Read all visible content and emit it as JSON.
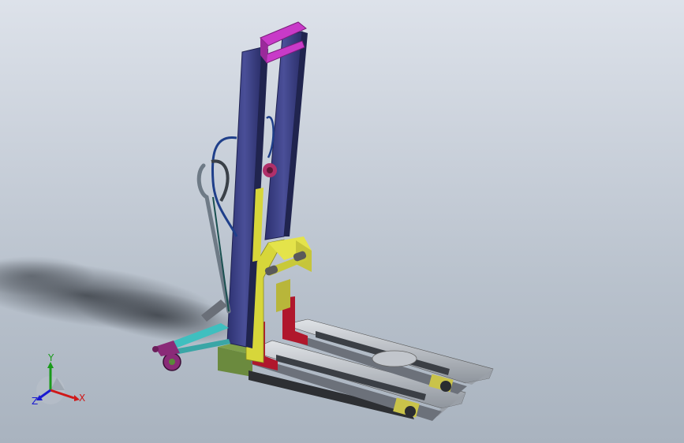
{
  "viewport": {
    "triad": {
      "x_label": "X",
      "y_label": "Y",
      "z_label": "Z",
      "x_color": "#d01818",
      "y_color": "#1a9a1a",
      "z_color": "#1a1ad0"
    },
    "model": {
      "mast_color": "#3a3f86",
      "top_bar_color": "#c83ac8",
      "carriage_color": "#d7d63a",
      "fork_color": "#b9bdc4",
      "red_block_color": "#b0172c",
      "handle_color": "#6e7a86",
      "hose_color": "#1f3f8a",
      "base_color": "#6b8a3e",
      "wheel_color": "#8a2a78"
    }
  }
}
